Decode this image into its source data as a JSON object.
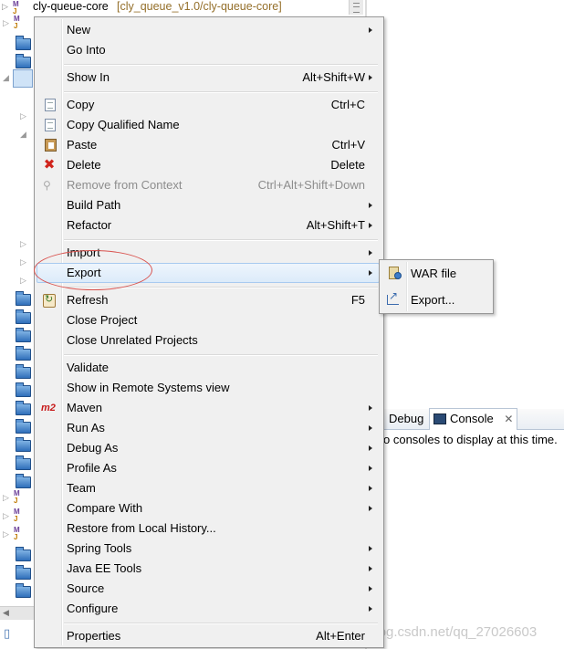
{
  "explorer": {
    "project_name": "cly-queue-core",
    "project_repo": "[cly_queue_v1.0/cly-queue-core]"
  },
  "console_view": {
    "debug_tab": "Debug",
    "console_tab": "Console",
    "message": "o consoles to display at this time."
  },
  "watermark": "https://blog.csdn.net/qq_27026603",
  "context_menu": {
    "new": {
      "label": "New"
    },
    "go_into": {
      "label": "Go Into"
    },
    "show_in": {
      "label": "Show In",
      "shortcut": "Alt+Shift+W"
    },
    "copy": {
      "label": "Copy",
      "shortcut": "Ctrl+C",
      "icon": "copy-icon"
    },
    "copy_qualified": {
      "label": "Copy Qualified Name",
      "icon": "copy-qualified-name-icon"
    },
    "paste": {
      "label": "Paste",
      "shortcut": "Ctrl+V",
      "icon": "paste-icon"
    },
    "delete": {
      "label": "Delete",
      "shortcut": "Delete",
      "icon": "delete-icon"
    },
    "remove_context": {
      "label": "Remove from Context",
      "shortcut": "Ctrl+Alt+Shift+Down",
      "enabled": false
    },
    "build_path": {
      "label": "Build Path"
    },
    "refactor": {
      "label": "Refactor",
      "shortcut": "Alt+Shift+T"
    },
    "import": {
      "label": "Import"
    },
    "export": {
      "label": "Export",
      "highlighted": true
    },
    "refresh": {
      "label": "Refresh",
      "shortcut": "F5",
      "icon": "refresh-icon"
    },
    "close_project": {
      "label": "Close Project"
    },
    "close_unrelated": {
      "label": "Close Unrelated Projects"
    },
    "validate": {
      "label": "Validate"
    },
    "show_remote": {
      "label": "Show in Remote Systems view"
    },
    "maven": {
      "label": "Maven",
      "icon_text": "m2"
    },
    "run_as": {
      "label": "Run As"
    },
    "debug_as": {
      "label": "Debug As"
    },
    "profile_as": {
      "label": "Profile As"
    },
    "team": {
      "label": "Team"
    },
    "compare_with": {
      "label": "Compare With"
    },
    "restore_history": {
      "label": "Restore from Local History..."
    },
    "spring_tools": {
      "label": "Spring Tools"
    },
    "java_ee_tools": {
      "label": "Java EE Tools"
    },
    "source": {
      "label": "Source"
    },
    "configure": {
      "label": "Configure"
    },
    "properties": {
      "label": "Properties",
      "shortcut": "Alt+Enter"
    }
  },
  "export_submenu": {
    "war_file": {
      "label": "WAR file",
      "icon": "war-file-icon"
    },
    "export": {
      "label": "Export...",
      "icon": "export-wizard-icon"
    }
  },
  "colors": {
    "menu_bg": "#f0f0f0",
    "highlight": "#dcebfa",
    "annotation": "#d9534f",
    "repo_text": "#946f2a"
  }
}
